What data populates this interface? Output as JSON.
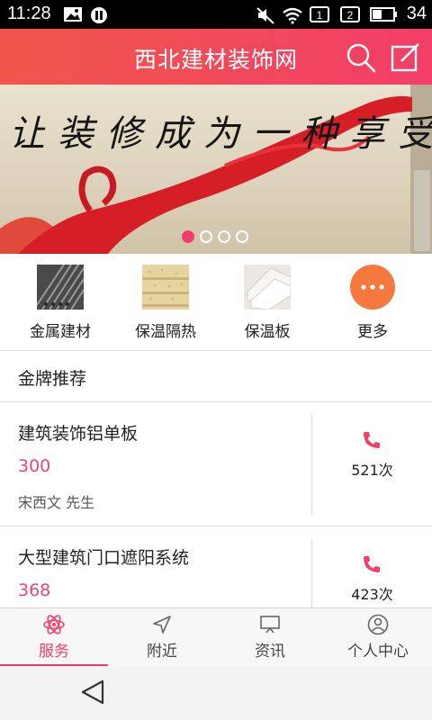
{
  "status_bar": {
    "time": "11:28",
    "sim1": "1",
    "sim2": "2",
    "battery": "34",
    "icons": [
      "image-icon",
      "pause-icon",
      "mute-icon",
      "wifi-icon",
      "sim-1-icon",
      "sim-2-icon",
      "battery-icon"
    ]
  },
  "header": {
    "title": "西北建材装饰网",
    "search_icon": "search-icon",
    "edit_icon": "edit-icon",
    "color": "#f23e68"
  },
  "banner": {
    "text": "让装修成为一种享受",
    "dot_count": 4,
    "active_dot": 0
  },
  "categories": [
    {
      "label": "金属建材",
      "icon": "metal-material-thumbnail"
    },
    {
      "label": "保温隔热",
      "icon": "insulation-thumbnail"
    },
    {
      "label": "保温板",
      "icon": "insulation-board-thumbnail"
    },
    {
      "label": "更多",
      "icon": "more-icon"
    }
  ],
  "section": {
    "title": "金牌推荐"
  },
  "items": [
    {
      "name": "建筑装饰铝单板",
      "price": "300",
      "contact": "宋西文 先生",
      "calls": "521次"
    },
    {
      "name": "大型建筑门口遮阳系统",
      "price": "368",
      "contact": "",
      "calls": "423次"
    }
  ],
  "tabs": [
    {
      "label": "服务",
      "icon": "atom-icon",
      "active": true
    },
    {
      "label": "附近",
      "icon": "location-arrow-icon",
      "active": false
    },
    {
      "label": "资讯",
      "icon": "monitor-icon",
      "active": false
    },
    {
      "label": "个人中心",
      "icon": "user-icon",
      "active": false
    }
  ],
  "colors": {
    "accent": "#f23e68",
    "price": "#e8457a"
  }
}
